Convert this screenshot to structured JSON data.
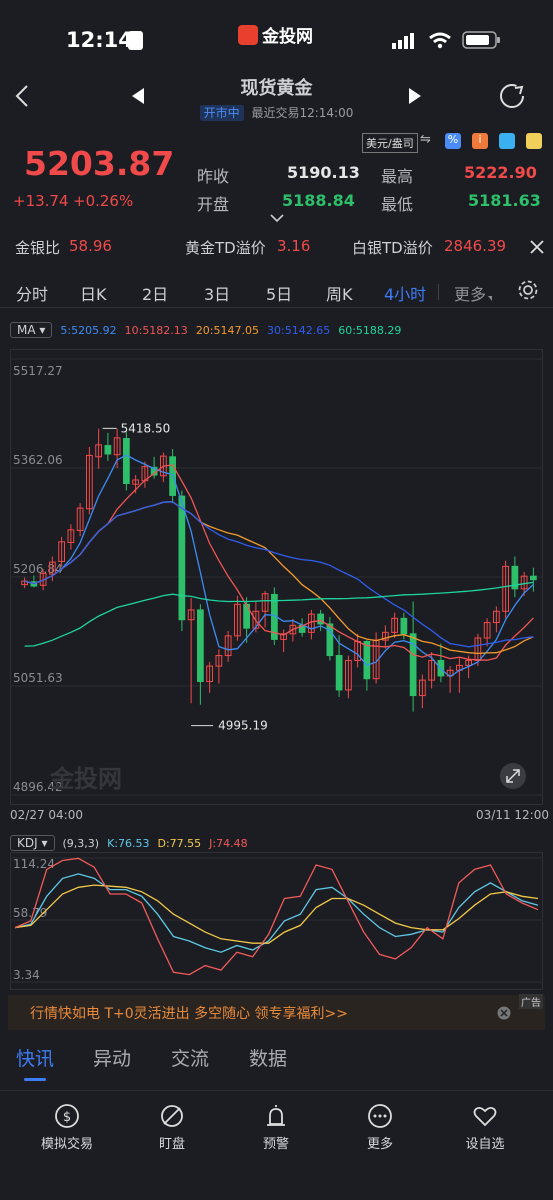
{
  "status_bar": {
    "time": "12:14",
    "brand": "金投网"
  },
  "header": {
    "title": "现货黄金",
    "market_status": "开市中",
    "last_trade": "最近交易12:14:00"
  },
  "quote": {
    "price": "5203.87",
    "change": "+13.74",
    "change_pct": "+0.26%",
    "prev_close_label": "昨收",
    "prev_close": "5190.13",
    "high_label": "最高",
    "high": "5222.90",
    "open_label": "开盘",
    "open": "5188.84",
    "low_label": "最低",
    "low": "5181.63",
    "unit_toggle": "美元/盎司"
  },
  "ratios": {
    "gold_silver_label": "金银比",
    "gold_silver": "58.96",
    "gold_td_label": "黄金TD溢价",
    "gold_td": "3.16",
    "silver_td_label": "白银TD溢价",
    "silver_td": "2846.39"
  },
  "period_tabs": [
    "分时",
    "日K",
    "2日",
    "3日",
    "5日",
    "周K",
    "4小时",
    "更多"
  ],
  "active_period": "4小时",
  "ma": {
    "button": "MA",
    "items": [
      {
        "label": "5:5205.92",
        "color": "#3d8cf5"
      },
      {
        "label": "10:5182.13",
        "color": "#f05555"
      },
      {
        "label": "20:5147.05",
        "color": "#f29a2e"
      },
      {
        "label": "30:5142.65",
        "color": "#2f5ef0"
      },
      {
        "label": "60:5188.29",
        "color": "#1fd4a0"
      }
    ]
  },
  "chart_data": [
    {
      "type": "candlestick",
      "y_ticks": [
        "5517.27",
        "5362.06",
        "5206.84",
        "5051.63",
        "4896.42"
      ],
      "ylim": [
        4896.42,
        5517.27
      ],
      "x_start": "02/27 04:00",
      "x_end": "03/11 12:00",
      "annotations": [
        {
          "label": "5418.50"
        },
        {
          "label": "4995.19"
        }
      ],
      "watermark": "金投网",
      "candles": [
        [
          5196,
          5206,
          5191,
          5201
        ],
        [
          5200,
          5209,
          5192,
          5194
        ],
        [
          5195,
          5218,
          5188,
          5212
        ],
        [
          5211,
          5236,
          5201,
          5228
        ],
        [
          5229,
          5264,
          5221,
          5257
        ],
        [
          5256,
          5282,
          5246,
          5274
        ],
        [
          5273,
          5312,
          5265,
          5305
        ],
        [
          5304,
          5392,
          5296,
          5380
        ],
        [
          5378,
          5418,
          5361,
          5395
        ],
        [
          5394,
          5412,
          5372,
          5382
        ],
        [
          5381,
          5418,
          5362,
          5405
        ],
        [
          5404,
          5413,
          5330,
          5340
        ],
        [
          5339,
          5352,
          5326,
          5345
        ],
        [
          5344,
          5371,
          5334,
          5364
        ],
        [
          5363,
          5378,
          5347,
          5352
        ],
        [
          5351,
          5384,
          5342,
          5379
        ],
        [
          5378,
          5389,
          5312,
          5323
        ],
        [
          5322,
          5330,
          5130,
          5146
        ],
        [
          5146,
          5177,
          5027,
          5160
        ],
        [
          5160,
          5168,
          5025,
          5058
        ],
        [
          5058,
          5086,
          5042,
          5080
        ],
        [
          5080,
          5104,
          5055,
          5095
        ],
        [
          5095,
          5130,
          5086,
          5123
        ],
        [
          5123,
          5180,
          5116,
          5168
        ],
        [
          5168,
          5178,
          5113,
          5134
        ],
        [
          5134,
          5172,
          5128,
          5158
        ],
        [
          5158,
          5187,
          5135,
          5183
        ],
        [
          5182,
          5192,
          5110,
          5118
        ],
        [
          5118,
          5132,
          5100,
          5126
        ],
        [
          5126,
          5147,
          5115,
          5138
        ],
        [
          5138,
          5148,
          5122,
          5128
        ],
        [
          5128,
          5160,
          5118,
          5154
        ],
        [
          5154,
          5160,
          5130,
          5140
        ],
        [
          5140,
          5150,
          5088,
          5095
        ],
        [
          5095,
          5124,
          5036,
          5046
        ],
        [
          5046,
          5095,
          5034,
          5088
        ],
        [
          5088,
          5126,
          5078,
          5115
        ],
        [
          5115,
          5117,
          5045,
          5062
        ],
        [
          5062,
          5128,
          5055,
          5117
        ],
        [
          5117,
          5138,
          5105,
          5128
        ],
        [
          5128,
          5156,
          5120,
          5148
        ],
        [
          5148,
          5156,
          5118,
          5126
        ],
        [
          5126,
          5172,
          5015,
          5038
        ],
        [
          5038,
          5068,
          5020,
          5060
        ],
        [
          5060,
          5100,
          5048,
          5088
        ],
        [
          5088,
          5112,
          5057,
          5066
        ],
        [
          5066,
          5080,
          5042,
          5074
        ],
        [
          5074,
          5092,
          5042,
          5081
        ],
        [
          5081,
          5095,
          5063,
          5088
        ],
        [
          5088,
          5126,
          5080,
          5120
        ],
        [
          5120,
          5148,
          5108,
          5142
        ],
        [
          5142,
          5165,
          5128,
          5158
        ],
        [
          5158,
          5230,
          5148,
          5222
        ],
        [
          5222,
          5236,
          5178,
          5190
        ],
        [
          5190,
          5214,
          5180,
          5208
        ],
        [
          5208,
          5220,
          5186,
          5203
        ]
      ]
    },
    {
      "type": "line",
      "indicator": "KDJ",
      "params": "(9,3,3)",
      "y_ticks": [
        "114.24",
        "58.79",
        "3.34"
      ],
      "ylim": [
        3.34,
        114.24
      ],
      "series": [
        {
          "name": "K:76.53",
          "color": "#5ec8e6",
          "values": [
            52,
            55,
            80,
            96,
            100,
            96,
            86,
            86,
            80,
            64,
            44,
            40,
            34,
            30,
            36,
            32,
            40,
            58,
            64,
            86,
            88,
            78,
            64,
            52,
            44,
            46,
            50,
            48,
            70,
            84,
            92,
            84,
            76,
            72
          ]
        },
        {
          "name": "D:77.55",
          "color": "#f2c84a",
          "values": [
            52,
            54,
            68,
            82,
            88,
            90,
            89,
            88,
            84,
            76,
            64,
            56,
            48,
            42,
            40,
            38,
            38,
            48,
            54,
            70,
            78,
            78,
            72,
            64,
            56,
            52,
            50,
            50,
            60,
            72,
            82,
            84,
            80,
            78
          ]
        },
        {
          "name": "J:74.48",
          "color": "#f05a5a",
          "values": [
            52,
            58,
            104,
            112,
            114,
            106,
            82,
            82,
            74,
            42,
            12,
            10,
            18,
            14,
            30,
            26,
            46,
            78,
            80,
            108,
            104,
            76,
            48,
            28,
            24,
            34,
            52,
            42,
            92,
            104,
            108,
            82,
            74,
            68
          ]
        }
      ]
    }
  ],
  "ad": {
    "text": "行情快如电 T+0灵活进出 多空随心 领专享福利>>",
    "tag": "广告"
  },
  "news_tabs": [
    "快讯",
    "异动",
    "交流",
    "数据"
  ],
  "bottom_nav": [
    "模拟交易",
    "盯盘",
    "预警",
    "更多",
    "设自选"
  ]
}
